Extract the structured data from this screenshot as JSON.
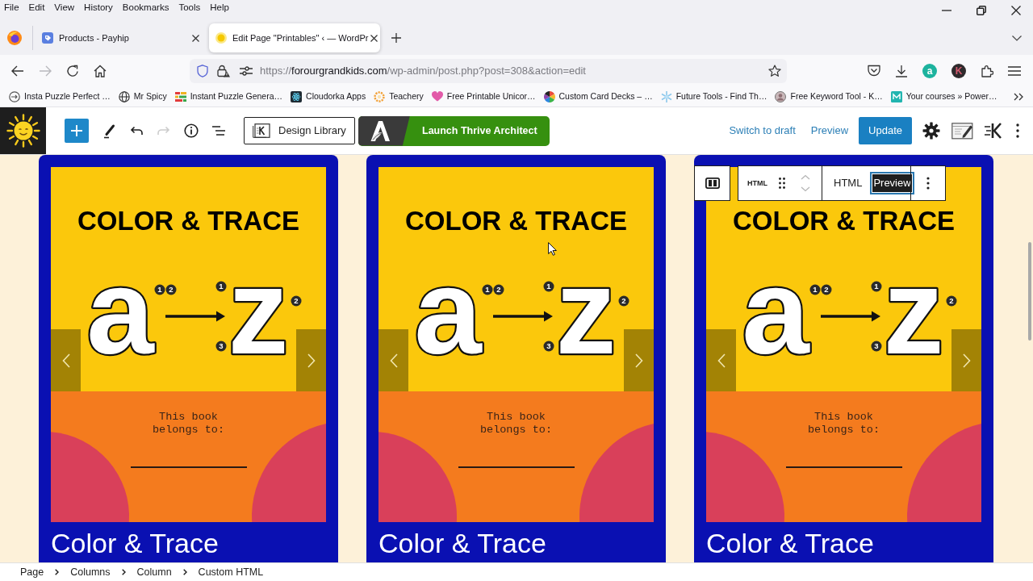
{
  "menu_bar": [
    "File",
    "Edit",
    "View",
    "History",
    "Bookmarks",
    "Tools",
    "Help"
  ],
  "tabs": [
    {
      "title": "Products - Payhip",
      "selected": false
    },
    {
      "title": "Edit Page \"Printables\" ‹ — WordPr",
      "selected": true
    }
  ],
  "address_bar": {
    "scheme": "https://",
    "host": "forourgrandkids.com",
    "path": "/wp-admin/post.php?post=308&action=edit"
  },
  "toolbar_badges": [
    {
      "letter": "a",
      "color": "#1db39e"
    },
    {
      "letter": "K",
      "color": "#2e2a2c"
    }
  ],
  "bookmarks": [
    "Insta Puzzle Perfect …",
    "Mr Spicy",
    "Instant Puzzle Genera…",
    "Cloudorka Apps",
    "Teachery",
    "Free Printable Unicor…",
    "Custom Card Decks – …",
    "Future Tools - Find Th…",
    "Free Keyword Tool - K…",
    "Your courses » Power…"
  ],
  "editor_toolbar": {
    "history": [
      {
        "kind": "undo",
        "disabled": false
      },
      {
        "kind": "redo",
        "disabled": true
      }
    ],
    "design_library": "Design Library",
    "launch_button": "Launch Thrive Architect",
    "switch_to_draft": "Switch to draft",
    "preview": "Preview",
    "update": "Update"
  },
  "cards": [
    {
      "cover": {
        "heading": "COLOR & TRACE",
        "start_letter": "a",
        "start_steps": [
          "1",
          "2"
        ],
        "end_letter": "z",
        "end_steps": [
          "1",
          "2",
          "3"
        ],
        "owner_label": "This book belongs to:"
      },
      "title": "Color & Trace"
    },
    {
      "cover": {
        "heading": "COLOR & TRACE",
        "start_letter": "a",
        "start_steps": [
          "1",
          "2"
        ],
        "end_letter": "z",
        "end_steps": [
          "1",
          "2",
          "3"
        ],
        "owner_label": "This book belongs to:"
      },
      "title": "Color & Trace"
    },
    {
      "cover": {
        "heading": "COLOR & TRACE",
        "start_letter": "a",
        "start_steps": [
          "1",
          "2"
        ],
        "end_letter": "z",
        "end_steps": [
          "1",
          "2",
          "3"
        ],
        "owner_label": "This book belongs to:"
      },
      "title": "Color & Trace",
      "block_toolbar": {
        "block_label": "HTML",
        "modes": [
          {
            "label": "HTML",
            "selected": false
          },
          {
            "label": "Preview",
            "selected": true
          }
        ]
      }
    }
  ],
  "breadcrumbs": [
    "Page",
    "Columns",
    "Column",
    "Custom HTML"
  ]
}
